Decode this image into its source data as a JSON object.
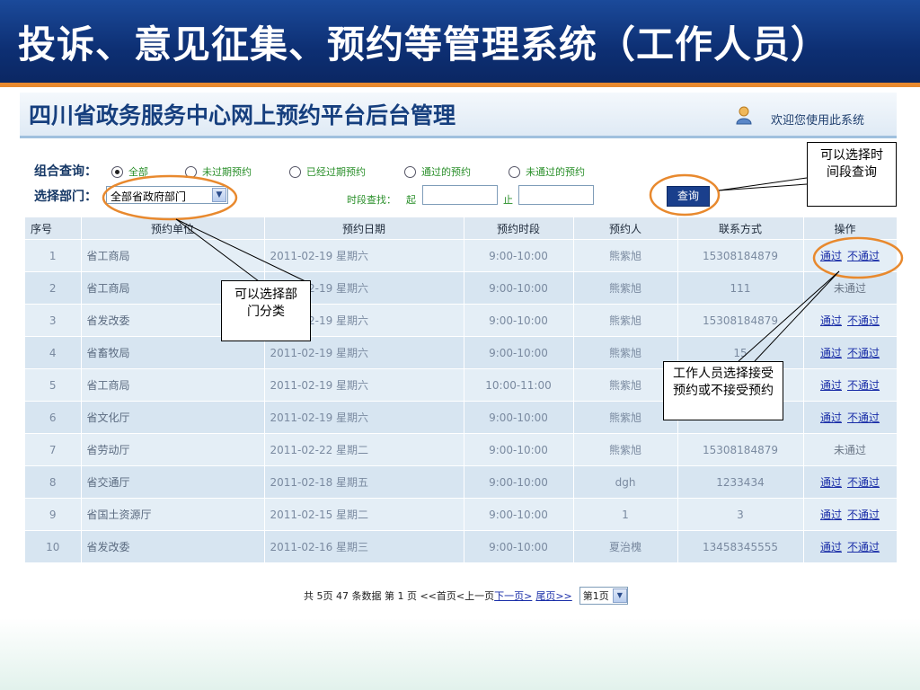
{
  "slide": {
    "title": "投诉、意见征集、预约等管理系统（工作人员）"
  },
  "header": {
    "title": "四川省政务服务中心网上预约平台后台管理",
    "welcome": "欢迎您使用此系统"
  },
  "filters": {
    "combo_label": "组合查询：",
    "options": [
      "全部",
      "未过期预约",
      "已经过期预约",
      "通过的预约",
      "未通过的预约"
    ],
    "selected_index": 0,
    "dept_label": "选择部门：",
    "dept_value": "全部省政府部门",
    "time_label": "时段查找：",
    "from_label": "起",
    "to_label": "止",
    "query_button": "查询"
  },
  "table": {
    "columns": [
      "序号",
      "预约单位",
      "预约日期",
      "预约时段",
      "预约人",
      "联系方式",
      "操作"
    ],
    "rows": [
      {
        "no": "1",
        "unit": "省工商局",
        "date": "2011-02-19 星期六",
        "slot": "9:00-10:00",
        "person": "熊紫旭",
        "contact": "15308184879",
        "status": "actions"
      },
      {
        "no": "2",
        "unit": "省工商局",
        "date": "2011-02-19 星期六",
        "slot": "9:00-10:00",
        "person": "熊紫旭",
        "contact": "111",
        "status": "未通过"
      },
      {
        "no": "3",
        "unit": "省发改委",
        "date": "2011-02-19 星期六",
        "slot": "9:00-10:00",
        "person": "熊紫旭",
        "contact": "15308184879",
        "status": "actions"
      },
      {
        "no": "4",
        "unit": "省畜牧局",
        "date": "2011-02-19 星期六",
        "slot": "9:00-10:00",
        "person": "熊紫旭",
        "contact": "15",
        "status": "actions"
      },
      {
        "no": "5",
        "unit": "省工商局",
        "date": "2011-02-19 星期六",
        "slot": "10:00-11:00",
        "person": "熊紫旭",
        "contact": "",
        "status": "actions"
      },
      {
        "no": "6",
        "unit": "省文化厅",
        "date": "2011-02-19 星期六",
        "slot": "9:00-10:00",
        "person": "熊紫旭",
        "contact": "",
        "status": "actions"
      },
      {
        "no": "7",
        "unit": "省劳动厅",
        "date": "2011-02-22 星期二",
        "slot": "9:00-10:00",
        "person": "熊紫旭",
        "contact": "15308184879",
        "status": "未通过"
      },
      {
        "no": "8",
        "unit": "省交通厅",
        "date": "2011-02-18 星期五",
        "slot": "9:00-10:00",
        "person": "dgh",
        "contact": "1233434",
        "status": "actions"
      },
      {
        "no": "9",
        "unit": "省国土资源厅",
        "date": "2011-02-15 星期二",
        "slot": "9:00-10:00",
        "person": "1",
        "contact": "3",
        "status": "actions"
      },
      {
        "no": "10",
        "unit": "省发改委",
        "date": "2011-02-16 星期三",
        "slot": "9:00-10:00",
        "person": "夏治槐",
        "contact": "13458345555",
        "status": "actions"
      }
    ],
    "approve_label": "通过",
    "reject_label": "不通过"
  },
  "pagination": {
    "summary": "共 5页 47 条数据 第 1 页 <<首页<上一页",
    "next": "下一页>",
    "last": "尾页>>",
    "page_select": "第1页"
  },
  "callouts": {
    "time": "可以选择时间段查询",
    "dept": "可以选择部门分类",
    "action": "工作人员选择接受预约或不接受预约"
  },
  "colors": {
    "title_bar": "#0d2f73",
    "accent_orange": "#e8892e",
    "link_blue": "#1a2ea8",
    "radio_green": "#2a8f2a"
  }
}
